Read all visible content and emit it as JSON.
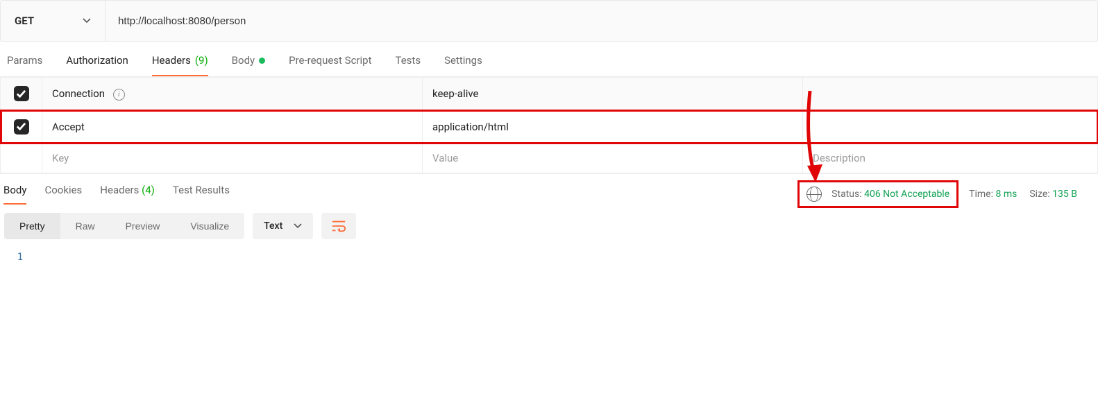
{
  "request": {
    "method": "GET",
    "url": "http://localhost:8080/person",
    "tabs": {
      "params": "Params",
      "authorization": "Authorization",
      "headers_label": "Headers",
      "headers_count": "(9)",
      "body": "Body",
      "prerequest": "Pre-request Script",
      "tests": "Tests",
      "settings": "Settings"
    },
    "headers": [
      {
        "key": "Connection",
        "value": "keep-alive",
        "info": true
      },
      {
        "key": "Accept",
        "value": "application/html",
        "info": false
      }
    ],
    "header_placeholders": {
      "key": "Key",
      "value": "Value",
      "description": "Description"
    }
  },
  "response": {
    "tabs": {
      "body": "Body",
      "cookies": "Cookies",
      "headers_label": "Headers",
      "headers_count": "(4)",
      "test_results": "Test Results"
    },
    "status_label": "Status:",
    "status_value": "406 Not Acceptable",
    "time_label": "Time:",
    "time_value": "8 ms",
    "size_label": "Size:",
    "size_value": "135 B",
    "view": {
      "pretty": "Pretty",
      "raw": "Raw",
      "preview": "Preview",
      "visualize": "Visualize",
      "format": "Text"
    },
    "line_number": "1"
  }
}
